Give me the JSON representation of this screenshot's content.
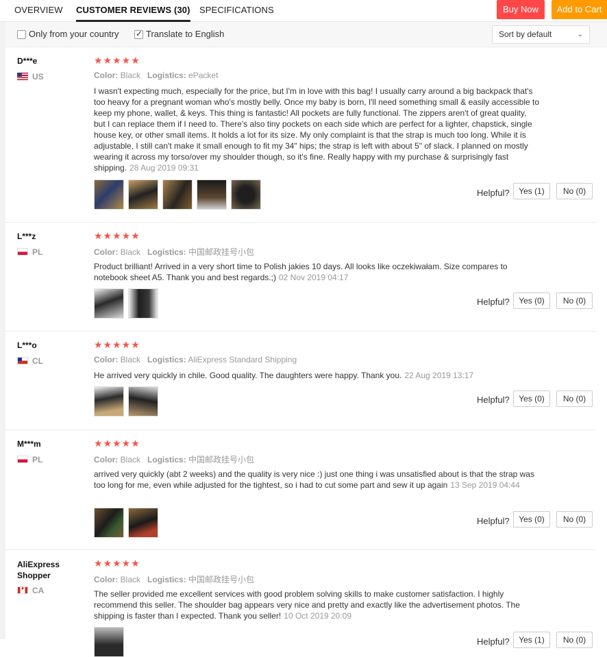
{
  "tabs": [
    {
      "label": "OVERVIEW"
    },
    {
      "label": "CUSTOMER REVIEWS (30)"
    },
    {
      "label": "SPECIFICATIONS"
    }
  ],
  "actions": {
    "buy_now": "Buy Now",
    "add_to_cart": "Add to Cart"
  },
  "colors": {
    "buy_now": "#ff4747",
    "add_to_cart": "#ff9a00",
    "stars": "#f5564a"
  },
  "filters": {
    "only_country": {
      "label": "Only from your country",
      "checked": false
    },
    "translate": {
      "label": "Translate to English",
      "checked": true
    },
    "sort": "Sort by default"
  },
  "labels": {
    "color": "Color:",
    "logistics": "Logistics:",
    "helpful": "Helpful?"
  },
  "reviews": [
    {
      "user": "D***e",
      "country": "US",
      "flag": "us",
      "rating": 5,
      "color": "Black",
      "logistics": "ePacket",
      "text": "I wasn't expecting much, especially for the price, but I'm in love with this bag! I usually carry around a big backpack that's too heavy for a pregnant woman who's mostly belly. Once my baby is born, I'll need something small & easily accessible to keep my phone, wallet, & keys. This thing is fantastic! All pockets are fully functional. The zippers aren't of great quality, but I can replace them if I need to. There's also tiny pockets on each side which are perfect for a lighter, chapstick, single house key, or other small items. It holds a lot for its size. My only complaint is that the strap is much too long. While it is adjustable, I still can't make it small enough to fit my 34\" hips; the strap is left with about 5\" of slack. I planned on mostly wearing it across my torso/over my shoulder though, so it's fine. Really happy with my purchase & surprisingly fast shipping.",
      "date": "28 Aug 2019 09:31",
      "photos": 5,
      "yes": "Yes (1)",
      "no": "No (0)"
    },
    {
      "user": "L***z",
      "country": "PL",
      "flag": "pl",
      "rating": 5,
      "color": "Black",
      "logistics": "中国邮政挂号小包",
      "text": "Product brilliant! Arrived in a very short time to Polish jakies 10 days. All looks like oczekiwałam. Size compares to notebook sheet A5. Thank you and best regards.;)",
      "date": "02 Nov 2019 04:17",
      "photos": 2,
      "yes": "Yes (0)",
      "no": "No (0)"
    },
    {
      "user": "L***o",
      "country": "CL",
      "flag": "cl",
      "rating": 5,
      "color": "Black",
      "logistics": "AliExpress Standard Shipping",
      "text": "He arrived very quickly in chile. Good quality. The daughters were happy. Thank you.",
      "date": "22 Aug 2019 13:17",
      "photos": 2,
      "yes": "Yes (0)",
      "no": "No (0)"
    },
    {
      "user": "M***m",
      "country": "PL",
      "flag": "pl",
      "rating": 5,
      "color": "Black",
      "logistics": "中国邮政挂号小包",
      "text": "arrived very quickly (abt 2 weeks) and the quality is very nice :) just one thing i was unsatisfied about is that the strap was too long for me, even while adjusted for the tightest, so i had to cut some part and sew it up again",
      "date": "13 Sep 2019 04:44",
      "photos": 2,
      "yes": "Yes (0)",
      "no": "No (0)"
    },
    {
      "user": "AliExpress Shopper",
      "country": "CA",
      "flag": "ca",
      "rating": 5,
      "color": "Black",
      "logistics": "中国邮政挂号小包",
      "text": "The seller provided me excellent services with good problem solving skills to make customer satisfaction. I highly recommend this seller. The shoulder bag appears very nice and pretty and exactly like the advertisement photos. The shipping is faster than I expected. Thank you seller!",
      "date": "10 Oct 2019 20:09",
      "photos": 1,
      "yes": "Yes (1)",
      "no": "No (0)"
    }
  ]
}
